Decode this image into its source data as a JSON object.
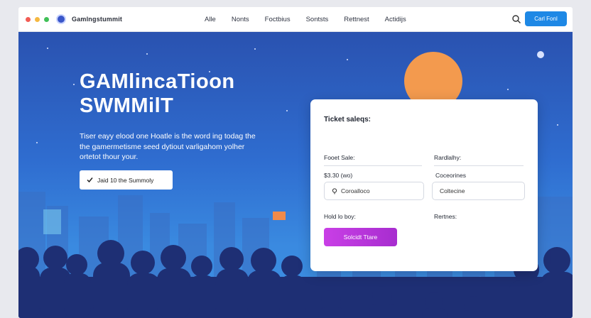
{
  "window": {
    "dot_colors": [
      "#f25c54",
      "#f5b841",
      "#40c057"
    ]
  },
  "brand": {
    "name": "Gamlngstummit",
    "logo_icon": "globe-logo-icon"
  },
  "nav": {
    "items": [
      "Alle",
      "Nonts",
      "Foctbius",
      "Sontsts",
      "Rettnest",
      "Actidijs"
    ],
    "search_icon": "search-icon",
    "cta_label": "Carl Fonl",
    "accent": "#1e88e5"
  },
  "hero": {
    "title_line1": "GAMlincaTioon",
    "title_line2": "SWMMilT",
    "subtitle": "Tiser eayy elood one Hoatle is the word ing todag the the gamermetisme seed dytiout varligahom yolher ortetot thour your.",
    "join_label": "Jaid 10 the Summoly"
  },
  "ticket": {
    "title": "Ticket saleqs:",
    "left_label": "Fooet Sale:",
    "left_value": "$3.30 (wo)",
    "right_label": "Rardlalhy:",
    "right_value": "Coceorines",
    "left_input": "Coroalloco",
    "right_input": "Coltecine",
    "bottom_left_label": "Hold lo boy:",
    "bottom_right_label": "Rertnes:",
    "submit_label": "Solcidt Ttare",
    "submit_color": "#b834d8"
  }
}
